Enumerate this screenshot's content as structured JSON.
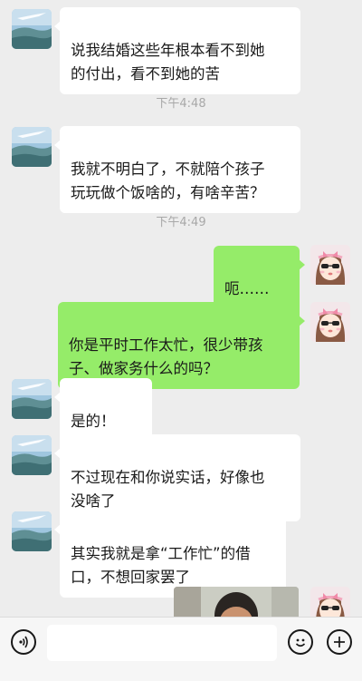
{
  "conversation": {
    "messages": [
      {
        "text": "说我结婚这些年根本看不到她\n的付出，看不到她的苦"
      },
      {
        "text": "我就不明白了，不就陪个孩子\n玩玩做个饭啥的，有啥辛苦？"
      },
      {
        "text": "呃……"
      },
      {
        "text": "你是平时工作太忙，很少带孩\n子、做家务什么的吗？"
      },
      {
        "text": "是的！"
      },
      {
        "text": "不过现在和你说实话，好像也\n没啥了"
      },
      {
        "text": "其实我就是拿“工作忙”的借\n口，不想回家罢了"
      }
    ],
    "timestamps": [
      "下午4:48",
      "下午4:49"
    ]
  },
  "toolbar": {
    "voice_icon": "voice-icon",
    "emoji_icon": "emoji-face-icon",
    "more_icon": "plus-icon",
    "input_value": ""
  },
  "colors": {
    "background": "#ededed",
    "sent_bubble": "#95ec69",
    "received_bubble": "#ffffff",
    "timestamp_text": "#a8a8a8"
  }
}
